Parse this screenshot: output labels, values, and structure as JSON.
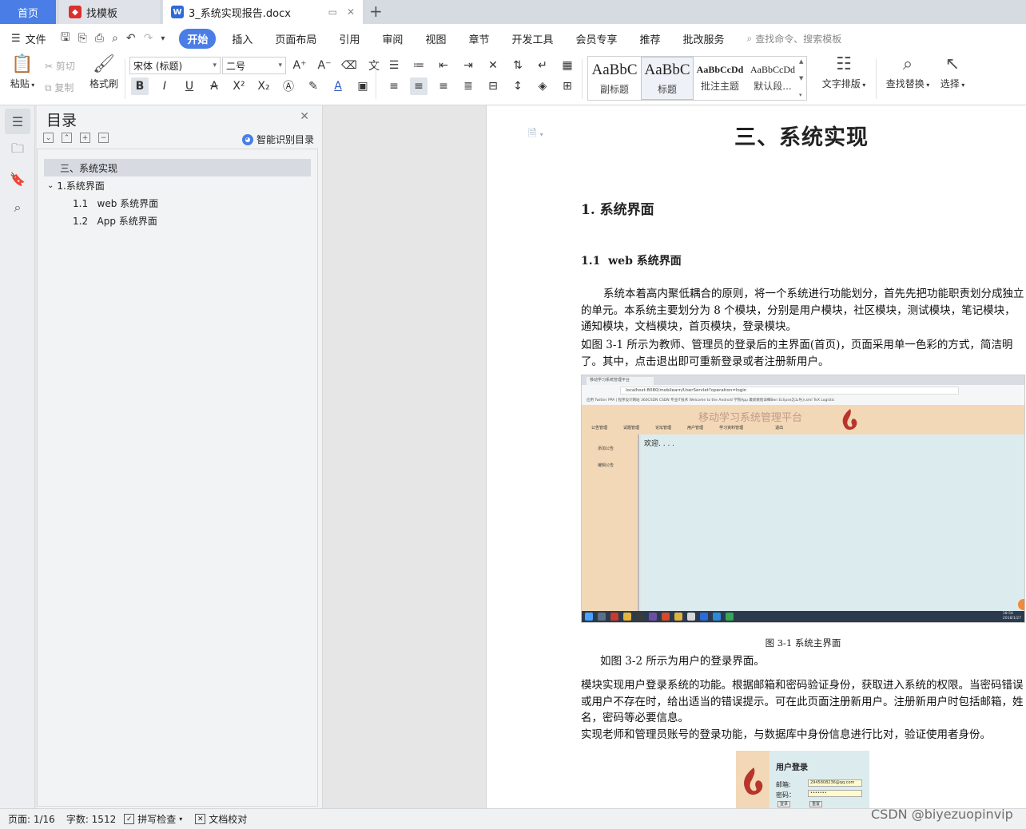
{
  "tabs": {
    "home": "首页",
    "template": "找模板",
    "document": "3_系统实现报告.docx",
    "add": "+"
  },
  "menu": {
    "file": "文件",
    "items": [
      "开始",
      "插入",
      "页面布局",
      "引用",
      "审阅",
      "视图",
      "章节",
      "开发工具",
      "会员专享",
      "推荐",
      "批改服务"
    ],
    "search_placeholder": "查找命令、搜索模板"
  },
  "ribbon": {
    "paste": "粘贴",
    "cut": "剪切",
    "copy": "复制",
    "format_painter": "格式刷",
    "font_name": "宋体 (标题)",
    "font_size": "二号",
    "styles": [
      {
        "sample": "AaBbC",
        "name": "副标题"
      },
      {
        "sample": "AaBbC",
        "name": "标题"
      },
      {
        "sample": "AaBbCcDd",
        "name": "批注主题"
      },
      {
        "sample": "AaBbCcDd",
        "name": "默认段..."
      }
    ],
    "text_layout": "文字排版",
    "find_replace": "查找替换",
    "select": "选择"
  },
  "toc": {
    "title": "目录",
    "smart": "智能识别目录",
    "items": [
      {
        "label": "三、系统实现"
      },
      {
        "label": "1.系统界面"
      },
      {
        "label": "1.1   web 系统界面"
      },
      {
        "label": "1.2   App 系统界面"
      }
    ]
  },
  "doc": {
    "heading_main": "三、系统实现",
    "heading_1": "1. 系统界面",
    "heading_2": "1.1  web 系统界面",
    "para_1": "系统本着高内聚低耦合的原则，将一个系统进行功能划分，首先先把功能职责划分成独立的单元。本系统主要划分为 8 个模块，分别是用户模块，社区模块，测试模块，笔记模块，通知模块，文档模块，首页模块，登录模块。",
    "para_2": "如图 3-1 所示为教师、管理员的登录后的主界面(首页)，页面采用单一色彩的方式，简洁明了。其中，点击退出即可重新登录或者注册新用户。",
    "caption_1": "图 3-1  系统主界面",
    "para_3": "如图 3-2 所示为用户的登录界面。",
    "para_4": "模块实现用户登录系统的功能。根据邮箱和密码验证身份，获取进入系统的权限。当密码错误或用户不存在时，给出适当的错误提示。可在此页面注册新用户。注册新用户时包括邮箱，姓名，密码等必要信息。",
    "para_5": "实现老师和管理员账号的登录功能，与数据库中身份信息进行比对，验证使用者身份。"
  },
  "fig1": {
    "tab_title": "移动学习系统管理平台",
    "url": "localhost:8080/mobilearn/UserServlet?operation=login",
    "bookmarks": "应用  Twitter  PPA | 程序设计网站  360CSDN  CSDN 专业IT技术  Welcome to the  Android 学院App  最新教程详细Ben  Eclipse怎么导入xml  TeX  Logistic",
    "site_title": "移动学习系统管理平台",
    "nav": [
      "公告管理",
      "试题管理",
      "论坛管理",
      "用户管理",
      "学习资料管理",
      "退出"
    ],
    "side": [
      "添加公告",
      "编辑公告"
    ],
    "welcome": "欢迎. . . .",
    "clock_time": "18:54",
    "clock_date": "2018/1/27"
  },
  "fig2": {
    "title": "用户登录",
    "email_label": "邮箱:",
    "email_value": "2945808236@qq.com",
    "password_label": "密码：",
    "password_value": "•••••••",
    "login": "登录",
    "reset": "重置"
  },
  "status": {
    "page": "页面: 1/16",
    "words": "字数: 1512",
    "spell": "拼写检查",
    "proof": "文档校对"
  },
  "watermark": "CSDN @biyezuopinvip",
  "colors": {
    "accent": "#4a7ee6",
    "page_bg": "#ffffff",
    "fig_header": "#f2d8b6",
    "fig_main": "#dcecee"
  }
}
